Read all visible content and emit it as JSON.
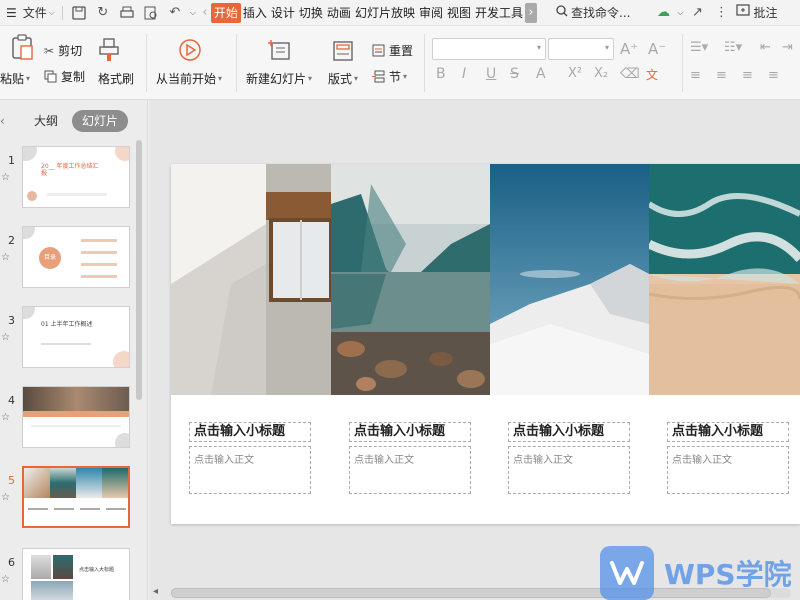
{
  "menubar": {
    "file_label": "文件",
    "tabs": [
      "开始",
      "插入",
      "设计",
      "切换",
      "动画",
      "幻灯片放映",
      "审阅",
      "视图",
      "开发工具"
    ],
    "search_label": "查找命令...",
    "comment_label": "批注"
  },
  "ribbon": {
    "paste_label": "粘贴",
    "cut_label": "剪切",
    "copy_label": "复制",
    "format_painter_label": "格式刷",
    "from_current_label": "从当前开始",
    "new_slide_label": "新建幻灯片",
    "layout_label": "版式",
    "reset_label": "重置",
    "section_label": "节",
    "font_buttons": [
      "B",
      "I",
      "U",
      "S",
      "A",
      "X²",
      "X₂"
    ]
  },
  "left_panel": {
    "tabs": [
      "大纲",
      "幻灯片"
    ],
    "active_tab": "幻灯片",
    "slides": [
      {
        "num": "1",
        "title": "20__ 年度工作总结汇报"
      },
      {
        "num": "2",
        "title": "目录"
      },
      {
        "num": "3",
        "title": "01 上半年工作概述"
      },
      {
        "num": "4",
        "title": ""
      },
      {
        "num": "5",
        "title": ""
      },
      {
        "num": "6",
        "title": "点击输入大标题"
      }
    ],
    "active_slide": "5"
  },
  "slide": {
    "columns": [
      {
        "subtitle": "点击输入小标题",
        "body": "点击输入正文"
      },
      {
        "subtitle": "点击输入小标题",
        "body": "点击输入正文"
      },
      {
        "subtitle": "点击输入小标题",
        "body": "点击输入正文"
      },
      {
        "subtitle": "点击输入小标题",
        "body": "点击输入正文"
      }
    ]
  },
  "watermark": {
    "text": "WPS学院"
  },
  "colors": {
    "accent": "#e8673a",
    "watermark": "#5491e8"
  }
}
